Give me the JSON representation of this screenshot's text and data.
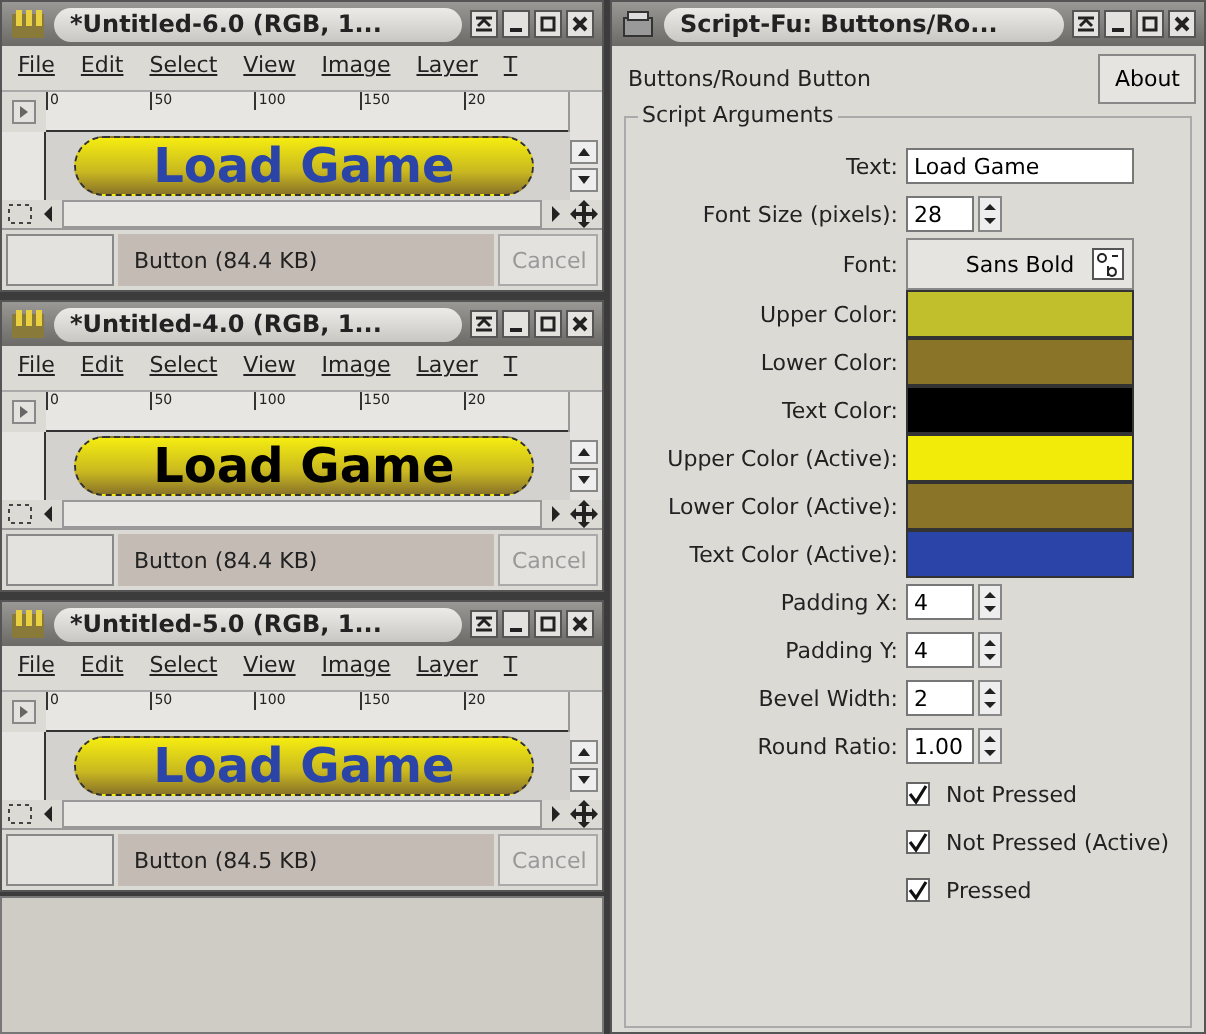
{
  "image_windows": [
    {
      "title": "*Untitled-6.0 (RGB, 1...",
      "menu": [
        "File",
        "Edit",
        "Select",
        "View",
        "Image",
        "Layer",
        "T"
      ],
      "ruler": [
        "0",
        "50",
        "100",
        "150",
        "20"
      ],
      "canvas_text": "Load Game",
      "color": "#2a44a8",
      "status": "Button (84.4 KB)",
      "cancel": "Cancel"
    },
    {
      "title": "*Untitled-4.0 (RGB, 1...",
      "menu": [
        "File",
        "Edit",
        "Select",
        "View",
        "Image",
        "Layer",
        "T"
      ],
      "ruler": [
        "0",
        "50",
        "100",
        "150",
        "20"
      ],
      "canvas_text": "Load Game",
      "color": "#000000",
      "status": "Button (84.4 KB)",
      "cancel": "Cancel"
    },
    {
      "title": "*Untitled-5.0 (RGB, 1...",
      "menu": [
        "File",
        "Edit",
        "Select",
        "View",
        "Image",
        "Layer",
        "T"
      ],
      "ruler": [
        "0",
        "50",
        "100",
        "150",
        "20"
      ],
      "canvas_text": "Load Game",
      "color": "#2a44a8",
      "status": "Button (84.5 KB)",
      "cancel": "Cancel"
    }
  ],
  "dialog": {
    "title": "Script-Fu: Buttons/Ro...",
    "heading": "Buttons/Round Button",
    "about": "About",
    "group": "Script Arguments",
    "rows": [
      {
        "kind": "text",
        "label": "Text:",
        "value": "Load Game"
      },
      {
        "kind": "spin",
        "label": "Font Size (pixels):",
        "value": "28"
      },
      {
        "kind": "font",
        "label": "Font:",
        "value": "Sans Bold"
      },
      {
        "kind": "color",
        "label": "Upper Color:",
        "color": "#c2bf2c"
      },
      {
        "kind": "color",
        "label": "Lower Color:",
        "color": "#8a7428"
      },
      {
        "kind": "color",
        "label": "Text Color:",
        "color": "#000000"
      },
      {
        "kind": "color",
        "label": "Upper Color (Active):",
        "color": "#f2ea08"
      },
      {
        "kind": "color",
        "label": "Lower Color (Active):",
        "color": "#8a7428"
      },
      {
        "kind": "color",
        "label": "Text Color (Active):",
        "color": "#2a44a8"
      },
      {
        "kind": "spin",
        "label": "Padding X:",
        "value": "4"
      },
      {
        "kind": "spin",
        "label": "Padding Y:",
        "value": "4"
      },
      {
        "kind": "spin",
        "label": "Bevel Width:",
        "value": "2"
      },
      {
        "kind": "spin",
        "label": "Round Ratio:",
        "value": "1.00"
      },
      {
        "kind": "check",
        "label": "Not Pressed",
        "checked": true
      },
      {
        "kind": "check",
        "label": "Not Pressed (Active)",
        "checked": true
      },
      {
        "kind": "check",
        "label": "Pressed",
        "checked": true
      }
    ]
  }
}
